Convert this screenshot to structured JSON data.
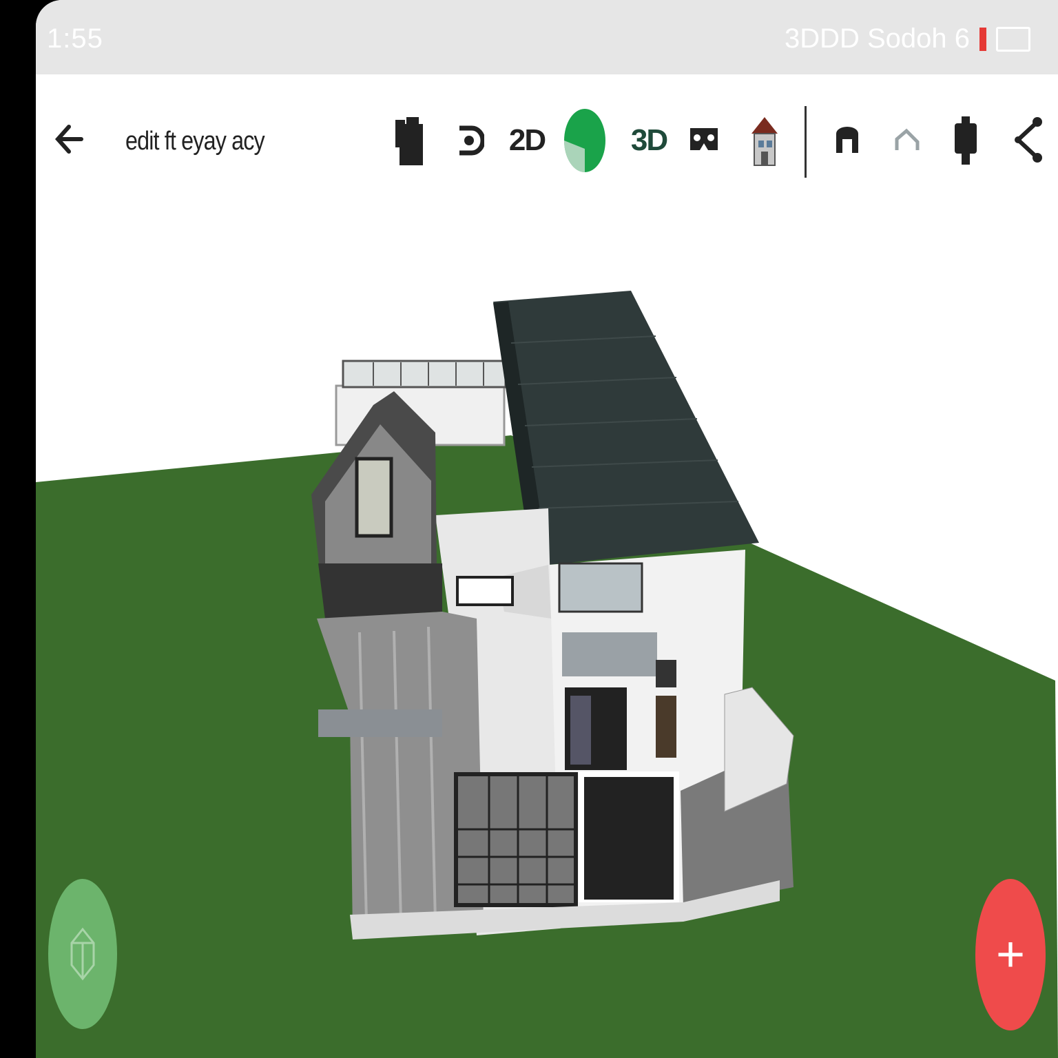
{
  "status_bar": {
    "time": "1:55",
    "right_text": "3DDD Sodoh 6"
  },
  "toolbar": {
    "project_title": "edit ft eyay acy",
    "mode_2d_label": "2D",
    "mode_3d_label": "3D",
    "accent_color": "#1aa34a",
    "icons": [
      "back-arrow-icon",
      "furniture-icon",
      "rotate-icon",
      "2d-view-icon",
      "green-indicator-icon",
      "3d-view-icon",
      "vr-headset-icon",
      "house-icon",
      "door-icon",
      "undo-icon",
      "settings-icon",
      "share-icon"
    ]
  },
  "fab": {
    "left_icon": "3d-box-icon",
    "right_label": "+",
    "left_color": "#6cb46c",
    "right_color": "#ef4b4b"
  },
  "scene": {
    "ground_color": "#3b6d2c",
    "roof_color": "#2f3a3a"
  }
}
